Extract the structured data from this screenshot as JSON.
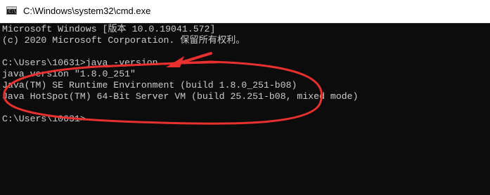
{
  "window": {
    "title": "C:\\Windows\\system32\\cmd.exe",
    "background": "#0c0c0c",
    "text_color": "#cccccc"
  },
  "icons": {
    "app": "cmd-console-icon"
  },
  "console": {
    "lines": [
      "Microsoft Windows [版本 10.0.19041.572]",
      "(c) 2020 Microsoft Corporation. 保留所有权利。",
      "",
      "C:\\Users\\10631>java -version",
      "java version \"1.8.0_251\"",
      "Java(TM) SE Runtime Environment (build 1.8.0_251-b08)",
      "Java HotSpot(TM) 64-Bit Server VM (build 25.251-b08, mixed mode)",
      "",
      "C:\\Users\\10631>"
    ]
  },
  "annotation": {
    "color": "#e8312f",
    "shapes": [
      "arrow",
      "ellipse"
    ]
  }
}
